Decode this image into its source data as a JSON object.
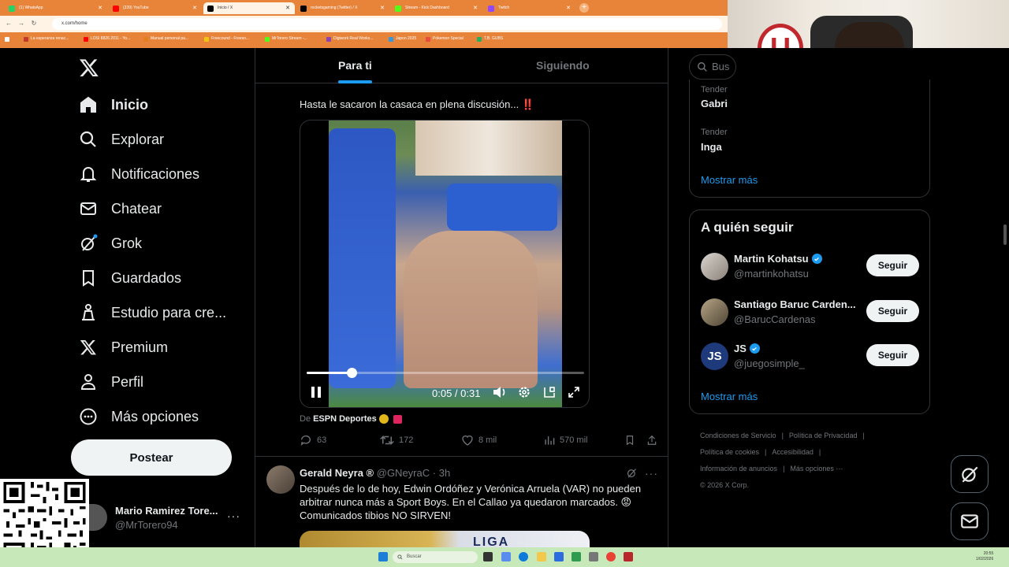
{
  "browser": {
    "tabs": [
      {
        "label": "(1) WhatsApp",
        "color": "#25d366"
      },
      {
        "label": "(339) YouTube",
        "color": "#ff0000"
      },
      {
        "label": "Inicio / X",
        "color": "#000000"
      },
      {
        "label": "rocketsgaming (Twitter) / X",
        "color": "#000000"
      },
      {
        "label": "Stream - Kick Dashboard",
        "color": "#53fc18"
      },
      {
        "label": "Twitch",
        "color": "#9146ff"
      }
    ],
    "url": "x.com/home",
    "bookmarks": [
      {
        "label": "La esperanza renac...",
        "color": "#c0392b"
      },
      {
        "label": "LOSI 8826 2011 - Yo...",
        "color": "#ff0000"
      },
      {
        "label": "Manual personal pa...",
        "color": "#e67e22"
      },
      {
        "label": "Freecound - Freeso...",
        "color": "#f1c40f"
      },
      {
        "label": "MrTorero Stream -...",
        "color": "#53fc18"
      },
      {
        "label": "Digiwork Real Works...",
        "color": "#8e44ad"
      },
      {
        "label": "Japon 2025",
        "color": "#3498db"
      },
      {
        "label": "Pokemon Special",
        "color": "#e74c3c"
      },
      {
        "label": "T.B. GUBS",
        "color": "#27ae60"
      }
    ]
  },
  "nav": {
    "items": [
      {
        "label": "Inicio",
        "icon": "home-icon"
      },
      {
        "label": "Explorar",
        "icon": "search-icon"
      },
      {
        "label": "Notificaciones",
        "icon": "bell-icon"
      },
      {
        "label": "Chatear",
        "icon": "mail-icon"
      },
      {
        "label": "Grok",
        "icon": "grok-icon"
      },
      {
        "label": "Guardados",
        "icon": "bookmark-icon"
      },
      {
        "label": "Estudio para cre...",
        "icon": "creator-studio-icon"
      },
      {
        "label": "Premium",
        "icon": "x-icon"
      },
      {
        "label": "Perfil",
        "icon": "person-icon"
      },
      {
        "label": "Más opciones",
        "icon": "more-circle-icon"
      }
    ],
    "post_label": "Postear",
    "account": {
      "name": "Mario Ramirez Tore...",
      "handle": "@MrTorero94",
      "more": "···"
    }
  },
  "feed": {
    "tabs": [
      "Para ti",
      "Siguiendo"
    ],
    "tweet1": {
      "text": "Hasta le sacaron la casaca en plena discusión... ‼️",
      "video": {
        "time": "0:05 / 0:31",
        "progress": 0.161
      },
      "source_prefix": "De",
      "source_name": "ESPN Deportes",
      "actions": {
        "replies": "63",
        "reposts": "172",
        "likes": "8 mil",
        "views": "570 mil"
      }
    },
    "tweet2": {
      "name": "Gerald Neyra ®",
      "handle": "@GNeyraC",
      "sep": "·",
      "time": "3h",
      "text": "Después de lo de hoy, Edwin Ordóñez y Verónica Arruela (VAR) no pueden arbitrar nunca más a Sport Boys. En el Callao ya quedaron marcados. 😡 Comunicados tibios NO SIRVEN!",
      "media_text": "LIGA"
    }
  },
  "sidebar": {
    "search_placeholder": "Bus",
    "trends": [
      {
        "category": "Tender",
        "name": "Gabri"
      },
      {
        "category": "Tender",
        "name": "Inga"
      }
    ],
    "show_more": "Mostrar más",
    "follow": {
      "title": "A quién seguir",
      "button": "Seguir",
      "users": [
        {
          "name": "Martin Kohatsu",
          "handle": "@martinkohatsu",
          "verified": true
        },
        {
          "name": "Santiago Baruc Carden...",
          "handle": "@BarucCardenas",
          "verified": false
        },
        {
          "name": "JS",
          "handle": "@juegosimple_",
          "verified": true
        }
      ],
      "show_more": "Mostrar más"
    },
    "footer": [
      "Condiciones de Servicio",
      "|",
      "Política de Privacidad",
      "|",
      "Política de cookies",
      "|",
      "Accesibilidad",
      "|",
      "Información de anuncios",
      "|",
      "Más opciones ···",
      "© 2026 X Corp."
    ]
  },
  "taskbar": {
    "search": "Buscar",
    "time": "20:55",
    "date": "1/02/2026"
  },
  "webcam": {
    "logo": "U"
  }
}
